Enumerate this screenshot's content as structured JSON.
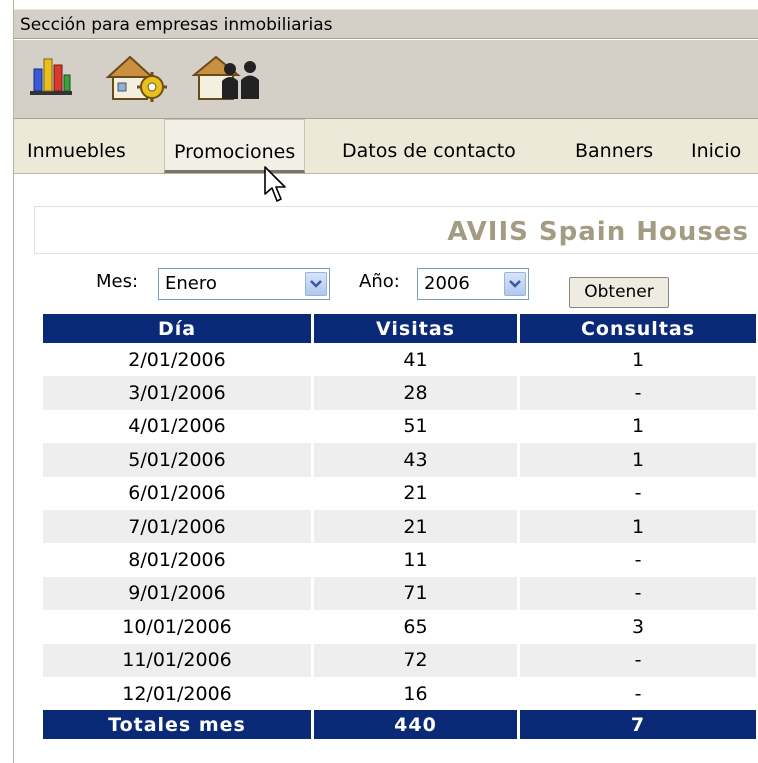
{
  "header": {
    "title": "Sección para empresas inmobiliarias"
  },
  "toolbar": {
    "icons": [
      "bar-chart-icon",
      "house-gear-icon",
      "house-people-icon"
    ]
  },
  "nav": {
    "items": [
      {
        "label": "Inmuebles"
      },
      {
        "label": "Promociones",
        "active": true
      },
      {
        "label": "Datos de contacto"
      },
      {
        "label": "Banners"
      },
      {
        "label": "Inicio"
      }
    ]
  },
  "company": {
    "name": "AVIIS Spain Houses"
  },
  "filters": {
    "month_label": "Mes:",
    "month_value": "Enero",
    "year_label": "Año:",
    "year_value": "2006",
    "submit_label": "Obtener"
  },
  "table": {
    "headers": [
      "Día",
      "Visitas",
      "Consultas"
    ],
    "rows": [
      [
        "2/01/2006",
        "41",
        "1"
      ],
      [
        "3/01/2006",
        "28",
        "-"
      ],
      [
        "4/01/2006",
        "51",
        "1"
      ],
      [
        "5/01/2006",
        "43",
        "1"
      ],
      [
        "6/01/2006",
        "21",
        "-"
      ],
      [
        "7/01/2006",
        "21",
        "1"
      ],
      [
        "8/01/2006",
        "11",
        "-"
      ],
      [
        "9/01/2006",
        "71",
        "-"
      ],
      [
        "10/01/2006",
        "65",
        "3"
      ],
      [
        "11/01/2006",
        "72",
        "-"
      ],
      [
        "12/01/2006",
        "16",
        "-"
      ]
    ],
    "totals": [
      "Totales mes",
      "440",
      "7"
    ]
  },
  "colors": {
    "header_bg": "#0a2a78",
    "alt_row": "#eeeeee",
    "brand_text": "#a49c82"
  }
}
